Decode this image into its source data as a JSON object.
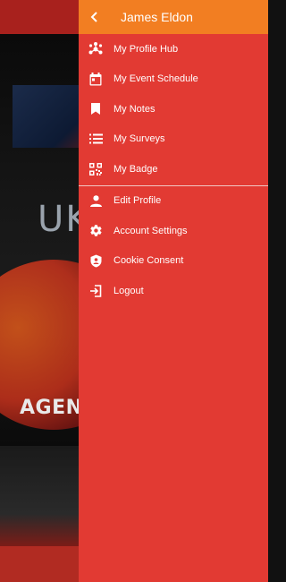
{
  "drawer": {
    "title": "James Eldon",
    "back_icon": "chevron-left-icon",
    "colors": {
      "header": "#f27e22",
      "panel": "#e23a33",
      "text": "#ffffff"
    },
    "primary_items": [
      {
        "label": "My Profile Hub",
        "icon": "hub-icon"
      },
      {
        "label": "My Event Schedule",
        "icon": "calendar-icon"
      },
      {
        "label": "My Notes",
        "icon": "bookmark-icon"
      },
      {
        "label": "My Surveys",
        "icon": "list-icon"
      },
      {
        "label": "My Badge",
        "icon": "qr-code-icon"
      }
    ],
    "secondary_items": [
      {
        "label": "Edit Profile",
        "icon": "person-icon"
      },
      {
        "label": "Account Settings",
        "icon": "gear-icon"
      },
      {
        "label": "Cookie Consent",
        "icon": "shield-user-icon"
      },
      {
        "label": "Logout",
        "icon": "logout-icon"
      }
    ]
  },
  "background": {
    "hero_text": "UK",
    "banner_text": "AGEND"
  }
}
